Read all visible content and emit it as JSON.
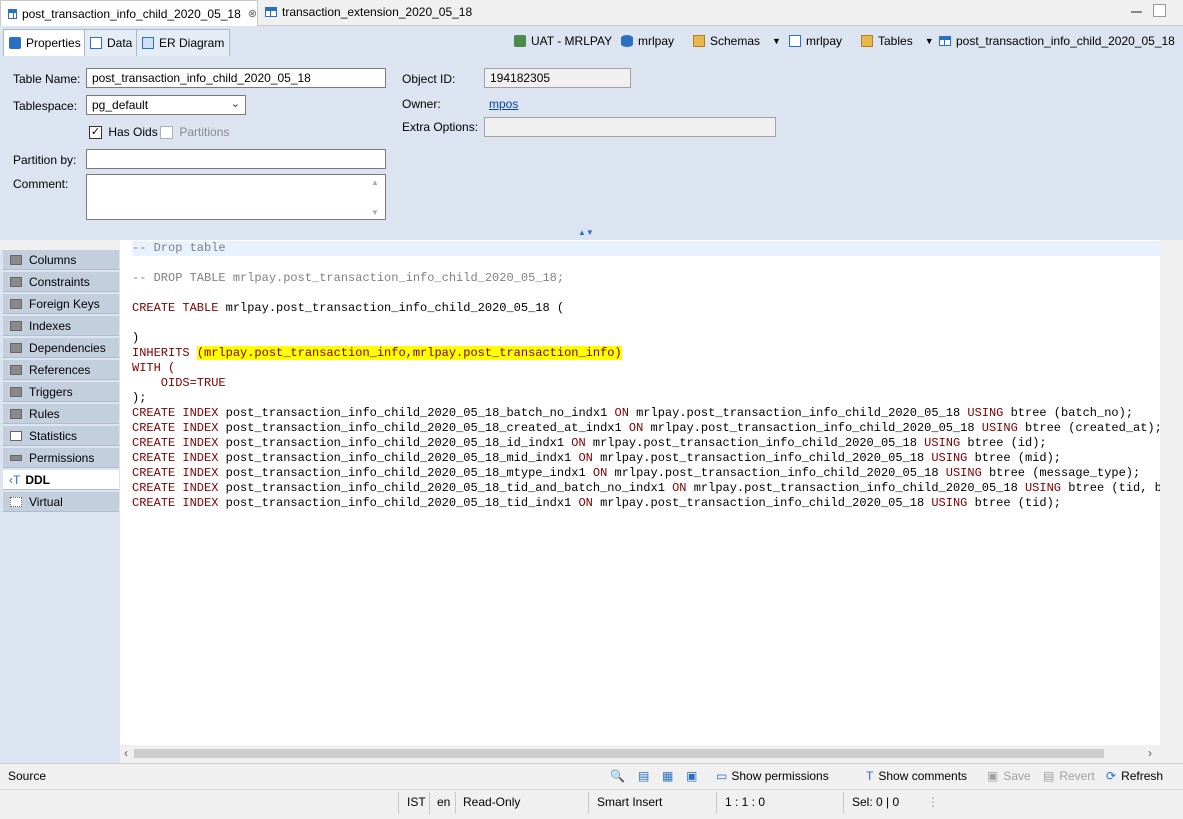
{
  "editor_tabs": [
    {
      "label": "post_transaction_info_child_2020_05_18",
      "active": true
    },
    {
      "label": "transaction_extension_2020_05_18",
      "active": false
    }
  ],
  "close_glyph": "⊗",
  "subtabs": [
    "Properties",
    "Data",
    "ER Diagram"
  ],
  "breadcrumb": {
    "connection": "UAT - MRLPAY",
    "database": "mrlpay",
    "schemas": "Schemas",
    "schema": "mrlpay",
    "tables": "Tables",
    "table": "post_transaction_info_child_2020_05_18"
  },
  "props": {
    "table_name_label": "Table Name:",
    "table_name_value": "post_transaction_info_child_2020_05_18",
    "tablespace_label": "Tablespace:",
    "tablespace_value": "pg_default",
    "has_oids_label": "Has Oids",
    "has_oids_checked": true,
    "partitions_label": "Partitions",
    "partition_by_label": "Partition by:",
    "partition_by_value": "",
    "comment_label": "Comment:",
    "comment_value": "",
    "object_id_label": "Object ID:",
    "object_id_value": "194182305",
    "owner_label": "Owner:",
    "owner_value": "mpos",
    "extra_options_label": "Extra Options:",
    "extra_options_value": ""
  },
  "sidenav": [
    "Columns",
    "Constraints",
    "Foreign Keys",
    "Indexes",
    "Dependencies",
    "References",
    "Triggers",
    "Rules",
    "Statistics",
    "Permissions",
    "DDL",
    "Virtual"
  ],
  "sidenav_active": "DDL",
  "ddl": {
    "drop_comment": "-- Drop table",
    "drop_stmt": "-- DROP TABLE mrlpay.post_transaction_info_child_2020_05_18;",
    "create_kw": "CREATE TABLE",
    "create_rest": " mrlpay.post_transaction_info_child_2020_05_18 (",
    "close_paren": ")",
    "inherits_kw": "INHERITS",
    "inherits_value": "(mrlpay.post_transaction_info,mrlpay.post_transaction_info)",
    "with_kw": "WITH (",
    "oids": "    OIDS=TRUE",
    "end": ");",
    "indexes": [
      {
        "name": "post_transaction_info_child_2020_05_18_batch_no_indx1",
        "table": "mrlpay.post_transaction_info_child_2020_05_18",
        "method": "btree (batch_no);"
      },
      {
        "name": "post_transaction_info_child_2020_05_18_created_at_indx1",
        "table": "mrlpay.post_transaction_info_child_2020_05_18",
        "method": "btree (created_at);"
      },
      {
        "name": "post_transaction_info_child_2020_05_18_id_indx1",
        "table": "mrlpay.post_transaction_info_child_2020_05_18",
        "method": "btree (id);"
      },
      {
        "name": "post_transaction_info_child_2020_05_18_mid_indx1",
        "table": "mrlpay.post_transaction_info_child_2020_05_18",
        "method": "btree (mid);"
      },
      {
        "name": "post_transaction_info_child_2020_05_18_mtype_indx1",
        "table": "mrlpay.post_transaction_info_child_2020_05_18",
        "method": "btree (message_type);"
      },
      {
        "name": "post_transaction_info_child_2020_05_18_tid_and_batch_no_indx1",
        "table": "mrlpay.post_transaction_info_child_2020_05_18",
        "method": "btree (tid, batch"
      },
      {
        "name": "post_transaction_info_child_2020_05_18_tid_indx1",
        "table": "mrlpay.post_transaction_info_child_2020_05_18",
        "method": "btree (tid);"
      }
    ],
    "create_index_kw": "CREATE INDEX",
    "on_kw": "ON",
    "using_kw": "USING"
  },
  "bottombar": {
    "source_label": "Source",
    "show_permissions": "Show permissions",
    "show_comments": "Show comments",
    "save": "Save",
    "revert": "Revert",
    "refresh": "Refresh"
  },
  "statusbar": {
    "timezone": "IST",
    "locale": "en",
    "mode": "Read-Only",
    "insert": "Smart Insert",
    "position": "1 : 1 : 0",
    "selection": "Sel: 0 | 0"
  }
}
